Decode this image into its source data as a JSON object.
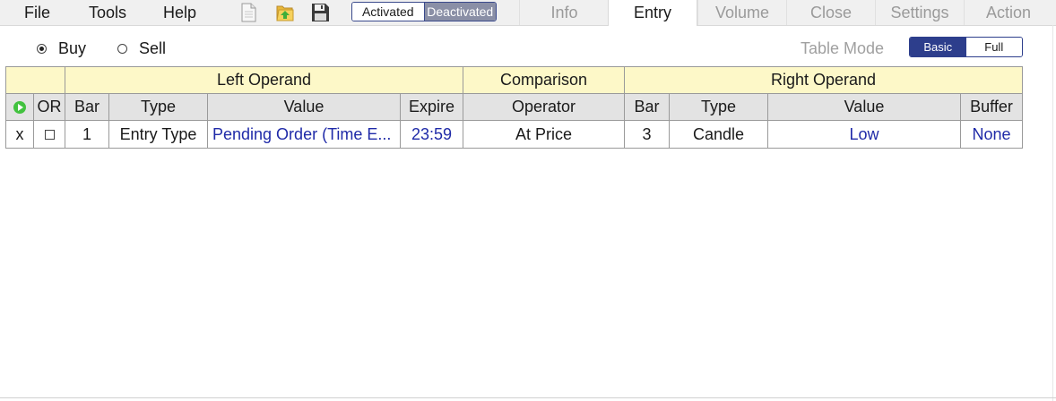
{
  "menu": {
    "file": "File",
    "tools": "Tools",
    "help": "Help"
  },
  "toolbar": {
    "icons": [
      "new-document-icon",
      "open-folder-icon",
      "save-icon"
    ],
    "activated_label": "Activated",
    "deactivated_label": "Deactivated",
    "selected": "Activated"
  },
  "tabs": [
    {
      "label": "Info"
    },
    {
      "label": "Entry",
      "active": true
    },
    {
      "label": "Volume"
    },
    {
      "label": "Close"
    },
    {
      "label": "Settings"
    },
    {
      "label": "Action"
    }
  ],
  "direction": {
    "buy_label": "Buy",
    "sell_label": "Sell",
    "selected": "Buy"
  },
  "table_mode": {
    "label": "Table Mode",
    "basic_label": "Basic",
    "full_label": "Full",
    "selected": "Basic"
  },
  "table": {
    "groups": {
      "left": "Left Operand",
      "comparison": "Comparison",
      "right": "Right Operand"
    },
    "headers": {
      "or": "OR",
      "bar": "Bar",
      "type": "Type",
      "value": "Value",
      "expire": "Expire",
      "operator": "Operator",
      "right_bar": "Bar",
      "right_type": "Type",
      "right_value": "Value",
      "buffer": "Buffer"
    },
    "rows": [
      {
        "delete": "x",
        "or_checked": false,
        "bar": "1",
        "type": "Entry Type",
        "value": "Pending Order (Time E...",
        "expire": "23:59",
        "operator": "At Price",
        "right_bar": "3",
        "right_type": "Candle",
        "right_value": "Low",
        "buffer": "None"
      }
    ]
  },
  "colors": {
    "accent": "#2d3e8c",
    "link_blue": "#1f2aa8",
    "group_header_bg": "#fdf8c8",
    "header_bg": "#e3e3e3",
    "play_green": "#42c23f"
  }
}
